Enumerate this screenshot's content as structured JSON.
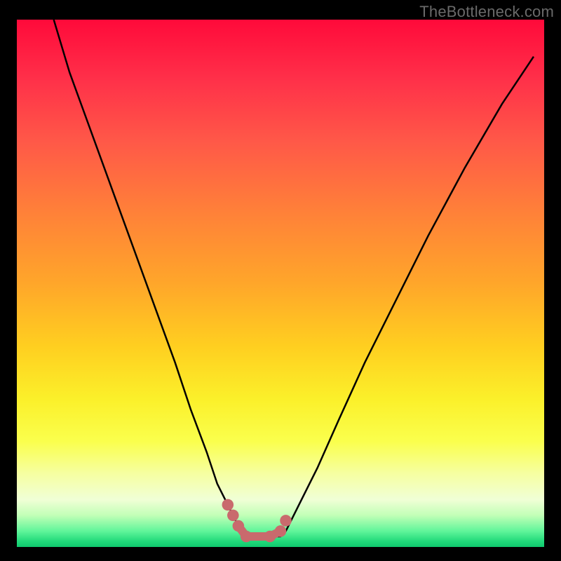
{
  "watermark": "TheBottleneck.com",
  "chart_data": {
    "type": "line",
    "title": "",
    "xlabel": "",
    "ylabel": "",
    "xlim": [
      0,
      100
    ],
    "ylim": [
      0,
      100
    ],
    "grid": false,
    "legend": false,
    "series": [
      {
        "name": "bottleneck-curve",
        "color": "#000000",
        "x": [
          7,
          10,
          14,
          18,
          22,
          26,
          30,
          33,
          36,
          38,
          40,
          41,
          42,
          43,
          44,
          46,
          48,
          50,
          51,
          52,
          54,
          57,
          61,
          66,
          72,
          78,
          85,
          92,
          98
        ],
        "y": [
          100,
          90,
          79,
          68,
          57,
          46,
          35,
          26,
          18,
          12,
          8,
          6,
          4,
          3,
          2,
          2,
          2,
          2,
          3,
          5,
          9,
          15,
          24,
          35,
          47,
          59,
          72,
          84,
          93
        ]
      },
      {
        "name": "bottom-markers",
        "color": "#c96a6d",
        "type": "scatter",
        "x": [
          40,
          41,
          42,
          43.5,
          48,
          50,
          51
        ],
        "y": [
          8,
          6,
          4,
          2,
          2,
          3,
          5
        ]
      }
    ],
    "marker_connector": {
      "color": "#c96a6d",
      "width": 12,
      "x": [
        42,
        43.5,
        46,
        48,
        50
      ],
      "y": [
        4,
        2,
        2,
        2,
        3
      ]
    },
    "gradient_stops": [
      {
        "pos": 0.0,
        "color": "#ff0a3a"
      },
      {
        "pos": 0.11,
        "color": "#ff2f49"
      },
      {
        "pos": 0.23,
        "color": "#ff5848"
      },
      {
        "pos": 0.37,
        "color": "#ff8238"
      },
      {
        "pos": 0.5,
        "color": "#ffa62a"
      },
      {
        "pos": 0.62,
        "color": "#ffcf20"
      },
      {
        "pos": 0.72,
        "color": "#fbf02a"
      },
      {
        "pos": 0.8,
        "color": "#faff4d"
      },
      {
        "pos": 0.86,
        "color": "#f6ffa0"
      },
      {
        "pos": 0.91,
        "color": "#f0ffd6"
      },
      {
        "pos": 0.94,
        "color": "#c2ffb7"
      },
      {
        "pos": 0.97,
        "color": "#60f59a"
      },
      {
        "pos": 0.99,
        "color": "#1fd879"
      },
      {
        "pos": 1.0,
        "color": "#10c86e"
      }
    ]
  }
}
